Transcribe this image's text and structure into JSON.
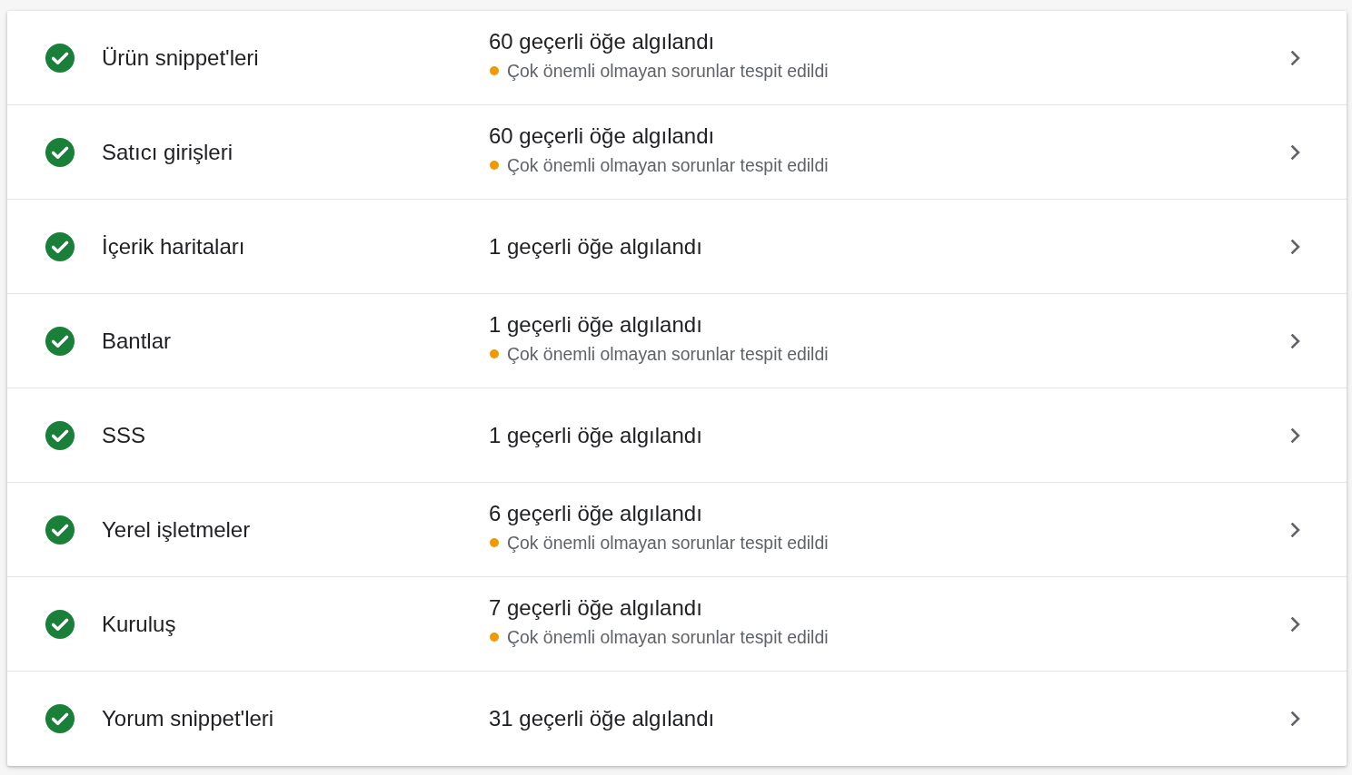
{
  "rows": [
    {
      "name": "Ürün snippet'leri",
      "valid": true,
      "summary": "60 geçerli öğe algılandı",
      "warning": "Çok önemli olmayan sorunlar tespit edildi"
    },
    {
      "name": "Satıcı girişleri",
      "valid": true,
      "summary": "60 geçerli öğe algılandı",
      "warning": "Çok önemli olmayan sorunlar tespit edildi"
    },
    {
      "name": "İçerik haritaları",
      "valid": true,
      "summary": "1 geçerli öğe algılandı"
    },
    {
      "name": "Bantlar",
      "valid": true,
      "summary": "1 geçerli öğe algılandı",
      "warning": "Çok önemli olmayan sorunlar tespit edildi"
    },
    {
      "name": "SSS",
      "valid": true,
      "summary": "1 geçerli öğe algılandı"
    },
    {
      "name": "Yerel işletmeler",
      "valid": true,
      "summary": "6 geçerli öğe algılandı",
      "warning": "Çok önemli olmayan sorunlar tespit edildi"
    },
    {
      "name": "Kuruluş",
      "valid": true,
      "summary": "7 geçerli öğe algılandı",
      "warning": "Çok önemli olmayan sorunlar tespit edildi"
    },
    {
      "name": "Yorum snippet'leri",
      "valid": true,
      "summary": "31 geçerli öğe algılandı"
    }
  ]
}
